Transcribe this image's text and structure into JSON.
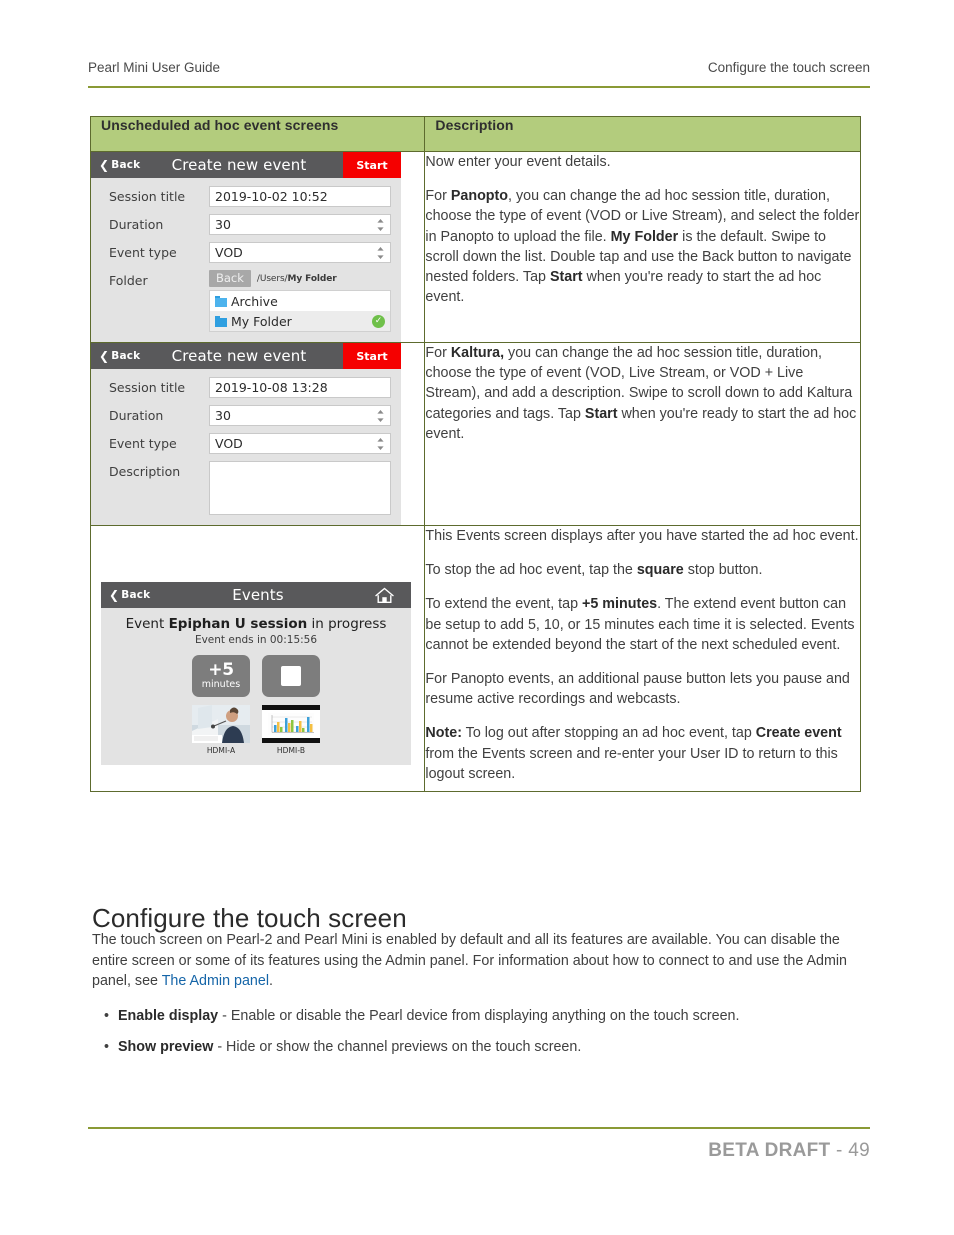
{
  "header": {
    "left": "Pearl Mini User Guide",
    "right": "Configure the touch screen"
  },
  "table": {
    "headers": {
      "col1": "Unscheduled ad hoc event screens",
      "col2": "Description"
    },
    "rows": [
      {
        "screen": {
          "back_label": "Back",
          "title": "Create new event",
          "action_label": "Start",
          "fields": {
            "session_title_label": "Session title",
            "session_title_value": "2019-10-02 10:52",
            "duration_label": "Duration",
            "duration_value": "30",
            "event_type_label": "Event type",
            "event_type_value": "VOD",
            "folder_label": "Folder"
          },
          "folder_picker": {
            "back_label": "Back",
            "path_prefix": "/Users/",
            "path_current": "My Folder",
            "items": [
              {
                "name": "Archive",
                "selected": false
              },
              {
                "name": "My Folder",
                "selected": true
              }
            ],
            "check_glyph": "✓"
          }
        },
        "description": [
          {
            "text": "Now enter your event details."
          },
          {
            "parts": [
              {
                "t": "For "
              },
              {
                "t": "Panopto",
                "b": true
              },
              {
                "t": ", you can change the ad hoc session title, duration, choose the type of event (VOD or Live Stream), and select the folder in Panopto to upload the file. "
              },
              {
                "t": "My Folder",
                "b": true
              },
              {
                "t": " is the default. Swipe to scroll down the list. Double tap and use the Back button to navigate nested folders. Tap "
              },
              {
                "t": "Start",
                "b": true
              },
              {
                "t": " when you're ready to start the ad hoc event."
              }
            ]
          }
        ]
      },
      {
        "screen": {
          "back_label": "Back",
          "title": "Create new event",
          "action_label": "Start",
          "fields": {
            "session_title_label": "Session title",
            "session_title_value": "2019-10-08 13:28",
            "duration_label": "Duration",
            "duration_value": "30",
            "event_type_label": "Event type",
            "event_type_value": "VOD",
            "description_label": "Description",
            "description_value": ""
          }
        },
        "description": [
          {
            "parts": [
              {
                "t": "For "
              },
              {
                "t": "Kaltura,",
                "b": true
              },
              {
                "t": " you can change the ad hoc session title, duration, choose the type of event (VOD, Live Stream, or VOD + Live Stream), and add a description. Swipe to scroll down to add Kaltura categories and tags. Tap "
              },
              {
                "t": "Start",
                "b": true
              },
              {
                "t": " when you're ready to start the ad hoc event."
              }
            ]
          }
        ]
      },
      {
        "screen": {
          "back_label": "Back",
          "title": "Events",
          "home_icon": "home-icon",
          "event_line_prefix": "Event ",
          "event_name": "Epiphan U session",
          "event_line_suffix": " in progress",
          "countdown": "Event ends in 00:15:56",
          "extend_button": {
            "amount": "+5",
            "unit": "minutes"
          },
          "stop_button": "stop-square",
          "channels": [
            {
              "caption": "HDMI-A"
            },
            {
              "caption": "HDMI-B"
            }
          ]
        },
        "description": [
          {
            "text": "This Events screen displays after you have started the ad hoc event."
          },
          {
            "parts": [
              {
                "t": "To stop the ad hoc event, tap the "
              },
              {
                "t": "square",
                "b": true
              },
              {
                "t": " stop button."
              }
            ]
          },
          {
            "parts": [
              {
                "t": "To extend the event, tap "
              },
              {
                "t": "+5 minutes",
                "b": true
              },
              {
                "t": ". The extend event button can be setup to add 5, 10, or 15 minutes each time it is selected. Events cannot be extended beyond the start of the next scheduled event."
              }
            ]
          },
          {
            "text": "For Panopto events, an additional pause button lets you pause and resume active recordings and webcasts."
          },
          {
            "parts": [
              {
                "t": "Note:",
                "b": true
              },
              {
                "t": " To log out after stopping an ad hoc event, tap "
              },
              {
                "t": "Create event",
                "b": true
              },
              {
                "t": " from the Events screen and re-enter your User ID to return to this logout screen."
              }
            ]
          }
        ]
      }
    ]
  },
  "section": {
    "heading": "Configure the touch screen",
    "paragraph_before_link": "The touch screen on Pearl-2 and Pearl Mini is enabled by default and all its features are available. You can disable the entire screen or some of its features using the Admin panel. For information about how to connect to and use the Admin panel, see ",
    "link_text": "The Admin panel",
    "paragraph_after_link": ".",
    "bullets": [
      {
        "term": "Enable display",
        "rest": " - Enable or disable the Pearl device from displaying anything on the touch screen."
      },
      {
        "term": "Show preview",
        "rest": " - Hide or show the channel previews on the touch screen."
      }
    ]
  },
  "footer": {
    "label": "BETA DRAFT",
    "separator": " - ",
    "page": "49"
  },
  "colors": {
    "table_header_green": "#b3cc7d",
    "rule_green": "#8a9a35",
    "table_border": "#5d6b2e",
    "start_red": "#f50000",
    "titlebar_gray": "#59595b",
    "screen_bg": "#e3e3e3",
    "link_blue": "#1565a8",
    "check_green": "#6fc04a",
    "folder_blue": "#2f9fe0"
  }
}
